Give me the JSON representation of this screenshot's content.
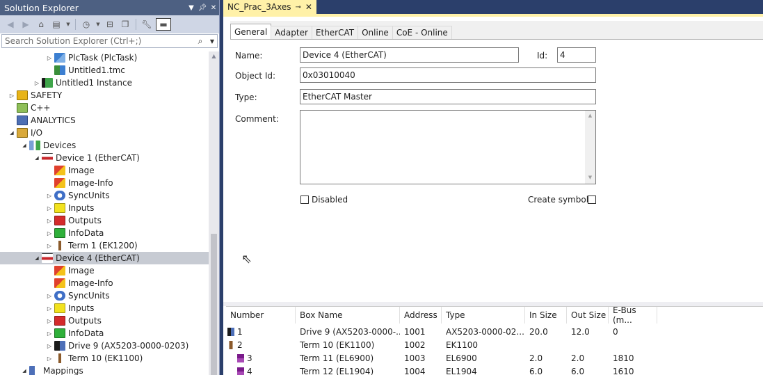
{
  "solution_explorer": {
    "title": "Solution Explorer",
    "search_placeholder": "Search Solution Explorer (Ctrl+;)",
    "tree": [
      {
        "label": "PlcTask (PlcTask)",
        "level": 3,
        "expander": "collapsed",
        "icon": "plc-task-icon"
      },
      {
        "label": "Untitled1.tmc",
        "level": 3,
        "expander": "none",
        "icon": "tmc-file-icon"
      },
      {
        "label": "Untitled1 Instance",
        "level": 2,
        "expander": "collapsed",
        "icon": "plc-instance-icon"
      },
      {
        "label": "SAFETY",
        "level": 0,
        "expander": "collapsed",
        "icon": "safety-icon"
      },
      {
        "label": "C++",
        "level": 0,
        "expander": "none",
        "icon": "cpp-icon"
      },
      {
        "label": "ANALYTICS",
        "level": 0,
        "expander": "none",
        "icon": "analytics-icon"
      },
      {
        "label": "I/O",
        "level": 0,
        "expander": "expanded",
        "icon": "io-icon"
      },
      {
        "label": "Devices",
        "level": 1,
        "expander": "expanded",
        "icon": "devices-icon"
      },
      {
        "label": "Device 1 (EtherCAT)",
        "level": 2,
        "expander": "expanded",
        "icon": "ethercat-device-icon"
      },
      {
        "label": "Image",
        "level": 3,
        "expander": "none",
        "icon": "image-icon"
      },
      {
        "label": "Image-Info",
        "level": 3,
        "expander": "none",
        "icon": "image-info-icon"
      },
      {
        "label": "SyncUnits",
        "level": 3,
        "expander": "collapsed",
        "icon": "sync-units-icon"
      },
      {
        "label": "Inputs",
        "level": 3,
        "expander": "collapsed",
        "icon": "inputs-icon"
      },
      {
        "label": "Outputs",
        "level": 3,
        "expander": "collapsed",
        "icon": "outputs-icon"
      },
      {
        "label": "InfoData",
        "level": 3,
        "expander": "collapsed",
        "icon": "info-data-icon"
      },
      {
        "label": "Term 1 (EK1200)",
        "level": 3,
        "expander": "collapsed",
        "icon": "terminal-icon"
      },
      {
        "label": "Device 4 (EtherCAT)",
        "level": 2,
        "expander": "expanded",
        "icon": "ethercat-device-icon",
        "selected": true
      },
      {
        "label": "Image",
        "level": 3,
        "expander": "none",
        "icon": "image-icon"
      },
      {
        "label": "Image-Info",
        "level": 3,
        "expander": "none",
        "icon": "image-info-icon"
      },
      {
        "label": "SyncUnits",
        "level": 3,
        "expander": "collapsed",
        "icon": "sync-units-icon"
      },
      {
        "label": "Inputs",
        "level": 3,
        "expander": "collapsed",
        "icon": "inputs-icon"
      },
      {
        "label": "Outputs",
        "level": 3,
        "expander": "collapsed",
        "icon": "outputs-icon"
      },
      {
        "label": "InfoData",
        "level": 3,
        "expander": "collapsed",
        "icon": "info-data-icon"
      },
      {
        "label": "Drive 9 (AX5203-0000-0203)",
        "level": 3,
        "expander": "collapsed",
        "icon": "drive-icon"
      },
      {
        "label": "Term 10 (EK1100)",
        "level": 3,
        "expander": "collapsed",
        "icon": "terminal-icon"
      },
      {
        "label": "Mappings",
        "level": 1,
        "expander": "expanded",
        "icon": "mappings-icon"
      }
    ]
  },
  "document": {
    "tab_title": "NC_Prac_3Axes",
    "tabs": [
      "General",
      "Adapter",
      "EtherCAT",
      "Online",
      "CoE - Online"
    ],
    "form": {
      "name_label": "Name:",
      "name_value": "Device 4 (EtherCAT)",
      "id_label": "Id:",
      "id_value": "4",
      "object_id_label": "Object Id:",
      "object_id_value": "0x03010040",
      "type_label": "Type:",
      "type_value": "EtherCAT Master",
      "comment_label": "Comment:",
      "comment_value": "",
      "disabled_label": "Disabled",
      "disabled_checked": false,
      "create_symbols_label": "Create symbols",
      "create_symbols_checked": false
    },
    "list": {
      "columns": [
        "Number",
        "Box Name",
        "Address",
        "Type",
        "In Size",
        "Out Size",
        "E-Bus (m..."
      ],
      "rows": [
        {
          "number": "1",
          "box_name": "Drive 9 (AX5203-0000-...",
          "address": "1001",
          "type": "AX5203-0000-02...",
          "in_size": "20.0",
          "out_size": "12.0",
          "ebus": "0",
          "icon": "drive-icon"
        },
        {
          "number": "2",
          "box_name": "Term 10 (EK1100)",
          "address": "1002",
          "type": "EK1100",
          "in_size": "",
          "out_size": "",
          "ebus": "",
          "icon": "terminal-icon"
        },
        {
          "number": "3",
          "box_name": "Term 11 (EL6900)",
          "address": "1003",
          "type": "EL6900",
          "in_size": "2.0",
          "out_size": "2.0",
          "ebus": "1810",
          "icon": "terminal-purple-icon"
        },
        {
          "number": "4",
          "box_name": "Term 12 (EL1904)",
          "address": "1004",
          "type": "EL1904",
          "in_size": "6.0",
          "out_size": "6.0",
          "ebus": "1610",
          "icon": "terminal-purple-icon"
        }
      ]
    }
  },
  "colors": {
    "title_bar": "#4d6082",
    "frame": "#2b3f6b",
    "doc_tab": "#fff1a8",
    "selected_row": "#c7cbd3"
  }
}
